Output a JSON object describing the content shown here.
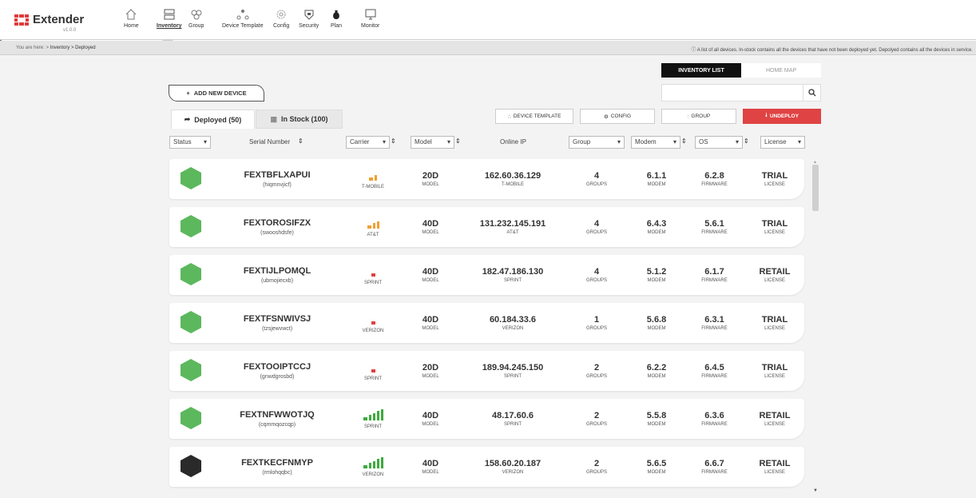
{
  "app": {
    "name": "Extender",
    "version": "v1.0.0"
  },
  "nav": [
    {
      "label": "Home",
      "icon": "home-icon"
    },
    {
      "label": "Inventory",
      "icon": "inventory-icon",
      "active": true
    },
    {
      "label": "Group",
      "icon": "group-icon"
    },
    {
      "label": "Device Template",
      "icon": "device-template-icon"
    },
    {
      "label": "Config",
      "icon": "config-icon"
    },
    {
      "label": "Security",
      "icon": "security-icon"
    },
    {
      "label": "Plan",
      "icon": "plan-icon"
    },
    {
      "label": "Monitor",
      "icon": "monitor-icon"
    }
  ],
  "breadcrumb": {
    "prefix": "You are here: >",
    "path": "Inventory > Deployed"
  },
  "info_text": "A list of all devices. In-stock contains all the devices that have not been deployed yet. Depolyed contains all the devices in service.",
  "view_toggle": {
    "list": "INVENTORY LIST",
    "map": "HOME MAP"
  },
  "add_device": "ADD NEW DEVICE",
  "search": {
    "placeholder": ""
  },
  "tabs": {
    "deployed": "Deployed (50)",
    "in_stock": "In Stock (100)"
  },
  "actions": {
    "device_template": "DEVICE TEMPLATE",
    "config": "CONFIG",
    "group": "GROUP",
    "undeploy": "UNDEPLOY"
  },
  "filters": {
    "status": "Status",
    "serial": "Serial Number",
    "carrier": "Carrier",
    "model": "Model",
    "online_ip": "Online IP",
    "group": "Group",
    "modem": "Modem",
    "os": "OS",
    "license": "License"
  },
  "colors": {
    "online": "#5cb85c",
    "offline": "#2a2a2a",
    "signal_orange": "#f0a030",
    "signal_red": "#e04040",
    "signal_green": "#3dab3d",
    "undeploy": "#e04343"
  },
  "devices": [
    {
      "status": "online",
      "serial": "FEXTBFLXAPUI",
      "alias": "(hiqmnvjicf)",
      "signal": 2,
      "signal_color": "orange",
      "carrier": "T-MOBILE",
      "model": "20D",
      "model_label": "MODEL",
      "ip": "162.60.36.129",
      "ip_carrier": "T-MOBILE",
      "groups": "4",
      "groups_label": "GROUPS",
      "modem": "6.1.1",
      "modem_label": "MODEM",
      "firmware": "6.2.8",
      "firmware_label": "FIRMWARE",
      "license": "TRIAL",
      "license_label": "LICENSE"
    },
    {
      "status": "online",
      "serial": "FEXTOROSIFZX",
      "alias": "(swooshdsfe)",
      "signal": 3,
      "signal_color": "orange",
      "carrier": "AT&T",
      "model": "40D",
      "model_label": "MODEL",
      "ip": "131.232.145.191",
      "ip_carrier": "AT&T",
      "groups": "4",
      "groups_label": "GROUPS",
      "modem": "6.4.3",
      "modem_label": "MODEM",
      "firmware": "5.6.1",
      "firmware_label": "FIRMWARE",
      "license": "TRIAL",
      "license_label": "LICENSE"
    },
    {
      "status": "online",
      "serial": "FEXTIJLPOMQL",
      "alias": "(ubmojiecxb)",
      "signal": 1,
      "signal_color": "red",
      "carrier": "SPRINT",
      "model": "40D",
      "model_label": "MODEL",
      "ip": "182.47.186.130",
      "ip_carrier": "SPRINT",
      "groups": "4",
      "groups_label": "GROUPS",
      "modem": "5.1.2",
      "modem_label": "MODEM",
      "firmware": "6.1.7",
      "firmware_label": "FIRMWARE",
      "license": "RETAIL",
      "license_label": "LICENSE"
    },
    {
      "status": "online",
      "serial": "FEXTFSNWIVSJ",
      "alias": "(tzsjewvwct)",
      "signal": 1,
      "signal_color": "red",
      "carrier": "VERIZON",
      "model": "40D",
      "model_label": "MODEL",
      "ip": "60.184.33.6",
      "ip_carrier": "VERIZON",
      "groups": "1",
      "groups_label": "GROUPS",
      "modem": "5.6.8",
      "modem_label": "MODEM",
      "firmware": "6.3.1",
      "firmware_label": "FIRMWARE",
      "license": "TRIAL",
      "license_label": "LICENSE"
    },
    {
      "status": "online",
      "serial": "FEXTOOIPTCCJ",
      "alias": "(gnwdgrosbd)",
      "signal": 1,
      "signal_color": "red",
      "carrier": "SPRINT",
      "model": "20D",
      "model_label": "MODEL",
      "ip": "189.94.245.150",
      "ip_carrier": "SPRINT",
      "groups": "2",
      "groups_label": "GROUPS",
      "modem": "6.2.2",
      "modem_label": "MODEM",
      "firmware": "6.4.5",
      "firmware_label": "FIRMWARE",
      "license": "TRIAL",
      "license_label": "LICENSE"
    },
    {
      "status": "online",
      "serial": "FEXTNFWWOTJQ",
      "alias": "(cqmmqozcqp)",
      "signal": 5,
      "signal_color": "green",
      "carrier": "SPRINT",
      "model": "40D",
      "model_label": "MODEL",
      "ip": "48.17.60.6",
      "ip_carrier": "SPRINT",
      "groups": "2",
      "groups_label": "GROUPS",
      "modem": "5.5.8",
      "modem_label": "MODEM",
      "firmware": "6.3.6",
      "firmware_label": "FIRMWARE",
      "license": "RETAIL",
      "license_label": "LICENSE"
    },
    {
      "status": "offline",
      "serial": "FEXTKECFNMYP",
      "alias": "(rmlohqqbc)",
      "signal": 5,
      "signal_color": "green",
      "carrier": "VERIZON",
      "model": "40D",
      "model_label": "MODEL",
      "ip": "158.60.20.187",
      "ip_carrier": "VERIZON",
      "groups": "2",
      "groups_label": "GROUPS",
      "modem": "5.6.5",
      "modem_label": "MODEM",
      "firmware": "6.6.7",
      "firmware_label": "FIRMWARE",
      "license": "RETAIL",
      "license_label": "LICENSE"
    }
  ]
}
